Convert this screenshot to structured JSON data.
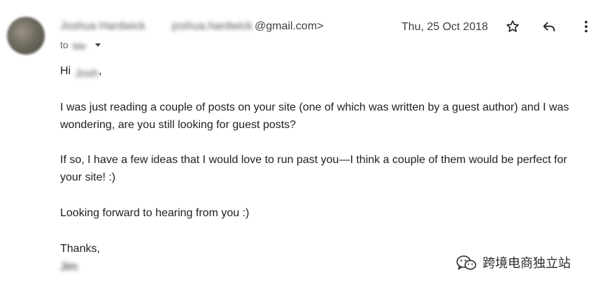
{
  "message": {
    "sender_name": "Joshua Hardwick",
    "sender_email_local": "joshua.hardwick",
    "sender_email_domain": "@gmail.com>",
    "recipient_prefix": "to",
    "recipient_name": "Me",
    "date": "Thu, 25 Oct 2018",
    "greeting_prefix": "Hi",
    "greeting_name": "Josh",
    "greeting_suffix": ",",
    "paragraph_1": "I was just reading a couple of posts on your site (one of which was written by a guest author) and I was wondering, are you still looking for guest posts?",
    "paragraph_2": "If so, I have a few ideas that I would love to run past you—I think a couple of them would be perfect for your site! :)",
    "paragraph_3": "Looking forward to hearing from you :)",
    "closing": "Thanks,",
    "signature": "Jim"
  },
  "actions": {
    "star_icon": "star-outline-icon",
    "reply_icon": "reply-icon",
    "more_icon": "more-vertical-icon"
  },
  "watermark": {
    "text": "跨境电商独立站"
  }
}
